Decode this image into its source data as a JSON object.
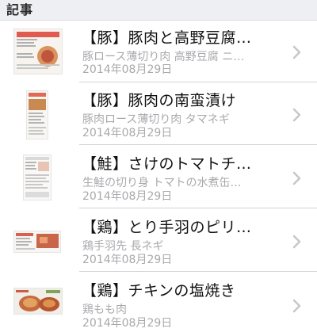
{
  "section": {
    "title": "記事"
  },
  "colors": {
    "header_bg": "#eeeff3",
    "title_text": "#111111",
    "secondary_text": "#a9a9ad",
    "chevron": "#c7c7cc",
    "separator": "#d4d4d8"
  },
  "items": [
    {
      "title": "【豚】豚肉と高野豆腐…",
      "subtitle": "豚ロース薄切り肉 高野豆腐 ニ…",
      "date": "2014年08月29日",
      "thumbnail_icon": "recipe-card-thumbnail",
      "chevron_icon": "chevron-right-icon"
    },
    {
      "title": "【豚】豚肉の南蛮漬け",
      "subtitle": "豚肉ロース薄切り肉 タマネギ",
      "date": "2014年08月29日",
      "thumbnail_icon": "recipe-card-thumbnail",
      "chevron_icon": "chevron-right-icon"
    },
    {
      "title": "【鮭】さけのトマトチ…",
      "subtitle": "生鮭の切り身 トマトの水煮缶…",
      "date": "2014年08月29日",
      "thumbnail_icon": "recipe-card-thumbnail",
      "chevron_icon": "chevron-right-icon"
    },
    {
      "title": "【鶏】とり手羽のピリ…",
      "subtitle": "鶏手羽先 長ネギ",
      "date": "2014年08月29日",
      "thumbnail_icon": "recipe-card-thumbnail",
      "chevron_icon": "chevron-right-icon"
    },
    {
      "title": "【鶏】チキンの塩焼き",
      "subtitle": "鶏もも肉",
      "date": "2014年08月29日",
      "thumbnail_icon": "recipe-photo-thumbnail",
      "chevron_icon": "chevron-right-icon"
    }
  ]
}
